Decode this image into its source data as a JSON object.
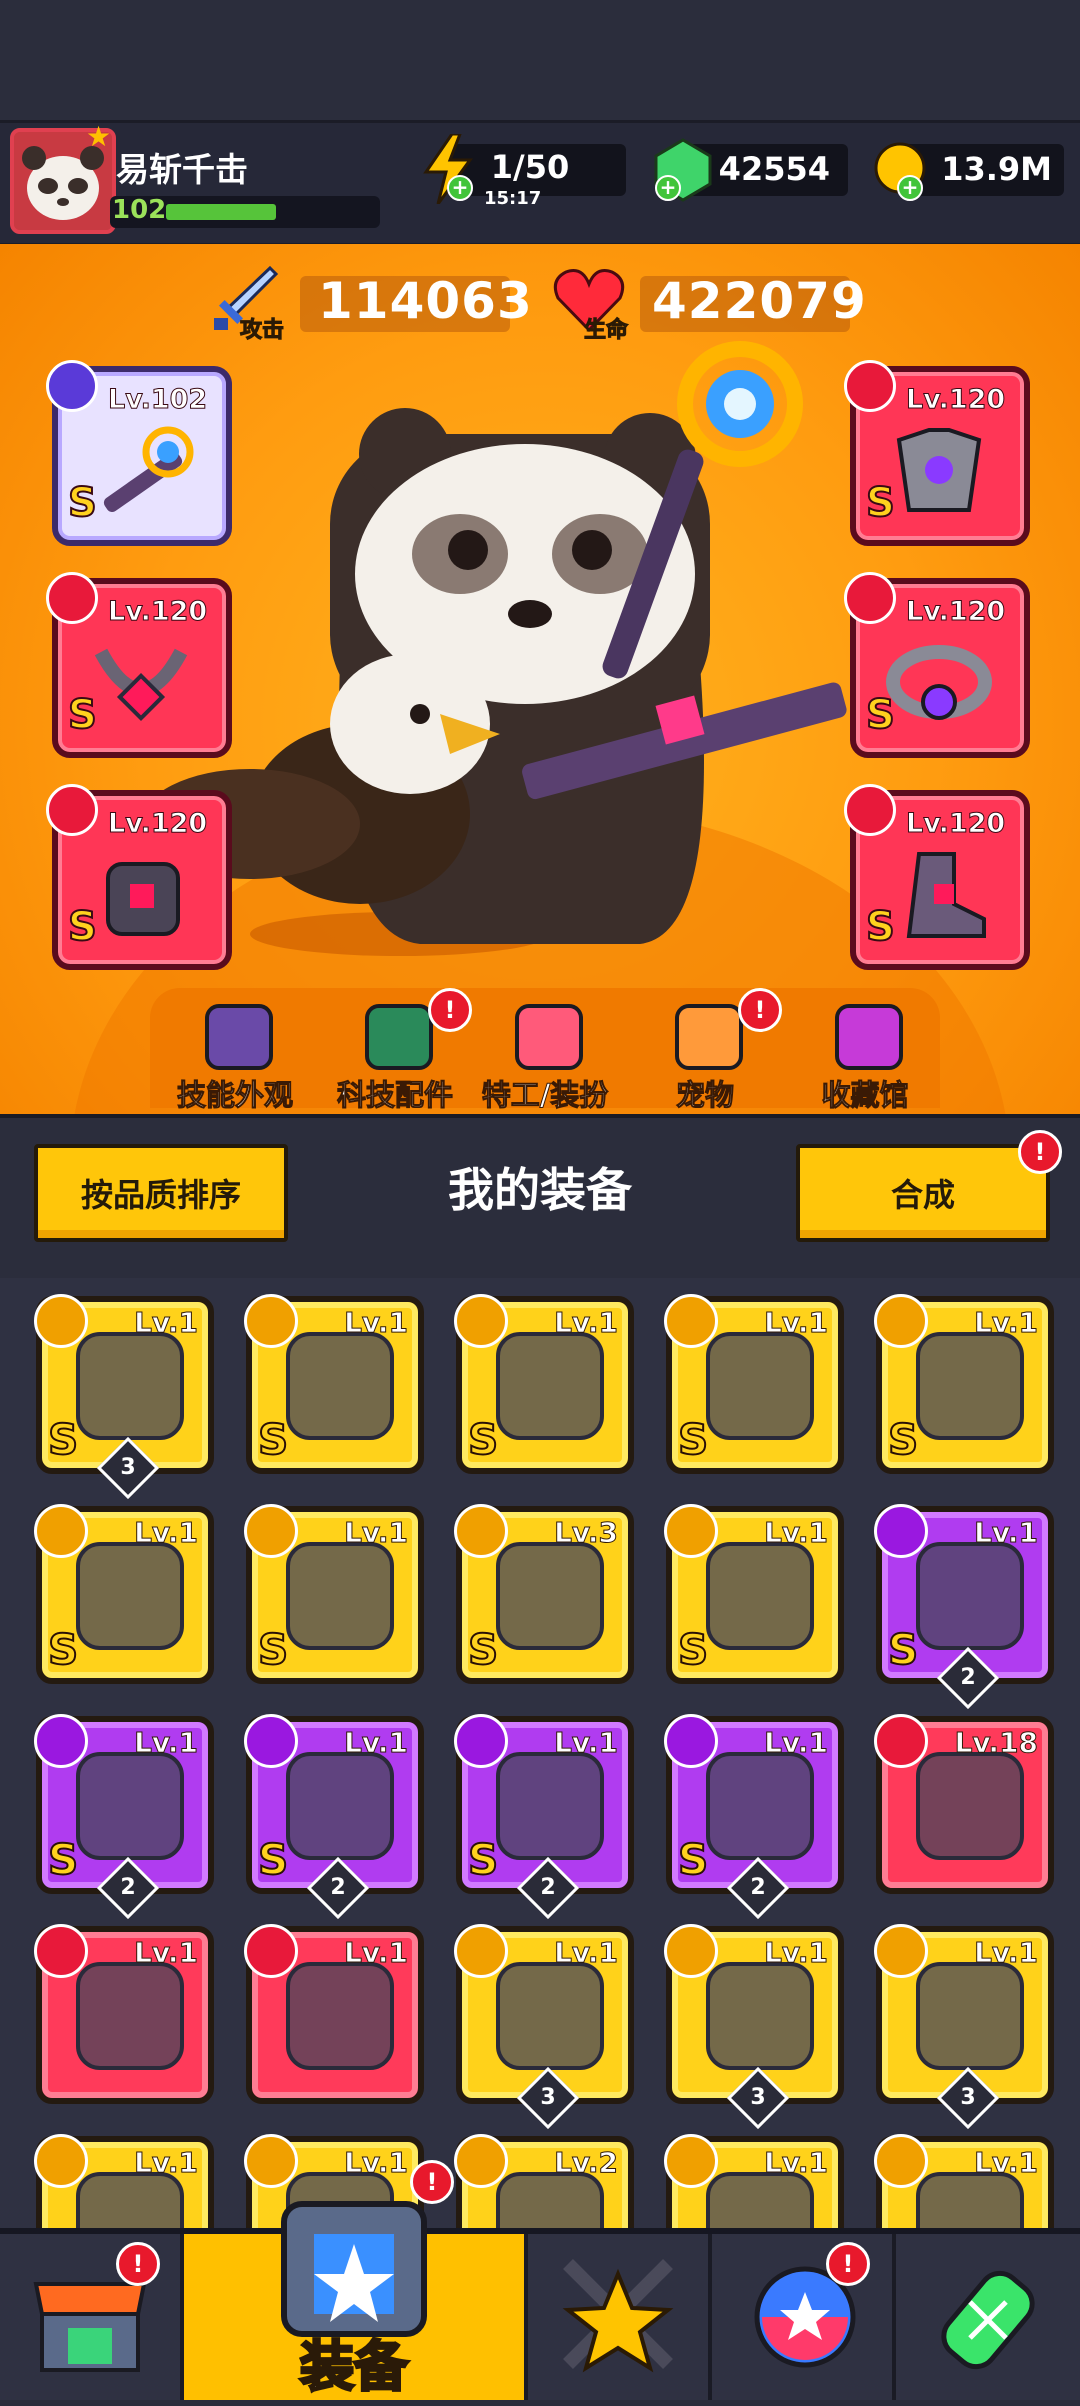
{
  "player": {
    "name": "易斩千击",
    "level": "102",
    "level_progress": 0.55
  },
  "resources": {
    "energy": "1/50",
    "energy_timer": "15:17",
    "gems": "42554",
    "gold": "13.9M"
  },
  "stats": {
    "attack_label": "攻击",
    "attack": "114063",
    "hp_label": "生命",
    "hp": "422079"
  },
  "equipped": {
    "weapon": {
      "level": "Lv.102",
      "rank": "S"
    },
    "armor": {
      "level": "Lv.120",
      "rank": "S"
    },
    "necklace": {
      "level": "Lv.120",
      "rank": "S"
    },
    "belt": {
      "level": "Lv.120",
      "rank": "S"
    },
    "gloves": {
      "level": "Lv.120",
      "rank": "S"
    },
    "boots": {
      "level": "Lv.120",
      "rank": "S"
    }
  },
  "menu": [
    {
      "label": "技能外观",
      "alert": false
    },
    {
      "label": "科技配件",
      "alert": true
    },
    {
      "label": "特工/装扮",
      "alert": false
    },
    {
      "label": "宠物",
      "alert": true
    },
    {
      "label": "收藏馆",
      "alert": false
    }
  ],
  "equipment_header": {
    "sort_label": "按品质排序",
    "title": "我的装备",
    "merge_label": "合成",
    "merge_alert": "!"
  },
  "items": [
    {
      "rarity": "y",
      "type": "necklace",
      "level": "Lv.1",
      "rank": "S",
      "count": "3"
    },
    {
      "rarity": "y",
      "type": "weapon",
      "level": "Lv.1",
      "rank": "S",
      "count": ""
    },
    {
      "rarity": "y",
      "type": "weapon",
      "level": "Lv.1",
      "rank": "S",
      "count": ""
    },
    {
      "rarity": "y",
      "type": "armor",
      "level": "Lv.1",
      "rank": "S",
      "count": ""
    },
    {
      "rarity": "y",
      "type": "armor",
      "level": "Lv.1",
      "rank": "S",
      "count": ""
    },
    {
      "rarity": "y",
      "type": "armor",
      "level": "Lv.1",
      "rank": "S",
      "count": ""
    },
    {
      "rarity": "y",
      "type": "necklace",
      "level": "Lv.1",
      "rank": "S",
      "count": ""
    },
    {
      "rarity": "y",
      "type": "gloves",
      "level": "Lv.3",
      "rank": "S",
      "count": ""
    },
    {
      "rarity": "y",
      "type": "gloves",
      "level": "Lv.1",
      "rank": "S",
      "count": ""
    },
    {
      "rarity": "p",
      "type": "weapon",
      "level": "Lv.1",
      "rank": "S",
      "count": "2"
    },
    {
      "rarity": "p",
      "type": "weapon",
      "level": "Lv.1",
      "rank": "S",
      "count": "2"
    },
    {
      "rarity": "p",
      "type": "necklace",
      "level": "Lv.1",
      "rank": "S",
      "count": "2"
    },
    {
      "rarity": "p",
      "type": "belt",
      "level": "Lv.1",
      "rank": "S",
      "count": "2"
    },
    {
      "rarity": "p",
      "type": "boots",
      "level": "Lv.1",
      "rank": "S",
      "count": "2"
    },
    {
      "rarity": "r",
      "type": "weapon",
      "level": "Lv.18",
      "rank": "",
      "count": ""
    },
    {
      "rarity": "r",
      "type": "weapon",
      "level": "Lv.1",
      "rank": "",
      "count": ""
    },
    {
      "rarity": "r",
      "type": "gloves",
      "level": "Lv.1",
      "rank": "",
      "count": ""
    },
    {
      "rarity": "y",
      "type": "necklace",
      "level": "Lv.1",
      "rank": "",
      "count": "3"
    },
    {
      "rarity": "y",
      "type": "belt",
      "level": "Lv.1",
      "rank": "",
      "count": "3"
    },
    {
      "rarity": "y",
      "type": "belt",
      "level": "Lv.1",
      "rank": "",
      "count": "3"
    },
    {
      "rarity": "y",
      "type": "belt",
      "level": "Lv.1",
      "rank": "",
      "count": ""
    },
    {
      "rarity": "y",
      "type": "gloves",
      "level": "Lv.1",
      "rank": "",
      "count": ""
    },
    {
      "rarity": "y",
      "type": "boots",
      "level": "Lv.2",
      "rank": "",
      "count": ""
    },
    {
      "rarity": "y",
      "type": "boots",
      "level": "Lv.1",
      "rank": "",
      "count": ""
    },
    {
      "rarity": "y",
      "type": "boots",
      "level": "Lv.1",
      "rank": "",
      "count": ""
    }
  ],
  "nav": [
    {
      "name": "shop",
      "label": "",
      "alert": true
    },
    {
      "name": "equipment",
      "label": "装备",
      "alert": true
    },
    {
      "name": "battle",
      "label": "",
      "alert": false
    },
    {
      "name": "gacha",
      "label": "",
      "alert": true
    },
    {
      "name": "evolve",
      "label": "",
      "alert": false
    }
  ],
  "alert_glyph": "!"
}
